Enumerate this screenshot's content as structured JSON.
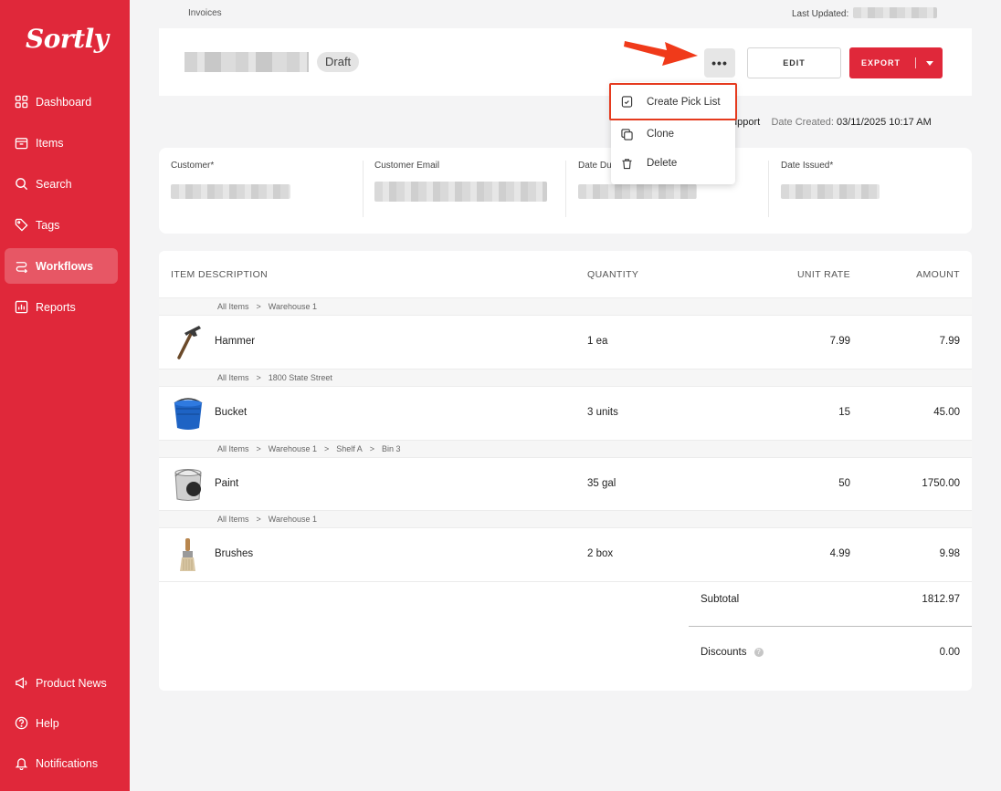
{
  "sidebar": {
    "logo": "Sortly",
    "items": [
      {
        "label": "Dashboard",
        "icon": "dashboard-icon",
        "active": false
      },
      {
        "label": "Items",
        "icon": "items-icon",
        "active": false
      },
      {
        "label": "Search",
        "icon": "search-icon",
        "active": false
      },
      {
        "label": "Tags",
        "icon": "tag-icon",
        "active": false
      },
      {
        "label": "Workflows",
        "icon": "workflows-icon",
        "active": true
      },
      {
        "label": "Reports",
        "icon": "reports-icon",
        "active": false
      }
    ],
    "bottom_items": [
      {
        "label": "Product News",
        "icon": "megaphone-icon"
      },
      {
        "label": "Help",
        "icon": "help-icon"
      },
      {
        "label": "Notifications",
        "icon": "bell-icon"
      }
    ]
  },
  "breadcrumb": "Invoices",
  "last_updated_label": "Last Updated:",
  "header": {
    "status": "Draft",
    "more_label": "•••",
    "edit_label": "EDIT",
    "export_label": "EXPORT"
  },
  "meta": {
    "support_fragment": "upport",
    "date_created_label": "Date Created:",
    "date_created_value": "03/11/2025 10:17 AM"
  },
  "details": {
    "customer_label": "Customer*",
    "email_label": "Customer Email",
    "date_due_label": "Date Du",
    "date_issued_label": "Date Issued*"
  },
  "menu": {
    "items": [
      {
        "label": "Create Pick List",
        "icon": "pick-list-icon"
      },
      {
        "label": "Clone",
        "icon": "clone-icon"
      },
      {
        "label": "Delete",
        "icon": "trash-icon"
      }
    ]
  },
  "table": {
    "headers": {
      "description": "ITEM DESCRIPTION",
      "quantity": "QUANTITY",
      "unit_rate": "UNIT RATE",
      "amount": "AMOUNT"
    },
    "rows": [
      {
        "path": [
          "All Items",
          "Warehouse 1"
        ],
        "name": "Hammer",
        "quantity": "1 ea",
        "unit_rate": "7.99",
        "amount": "7.99",
        "image": "hammer-image"
      },
      {
        "path": [
          "All Items",
          "1800 State Street"
        ],
        "name": "Bucket",
        "quantity": "3 units",
        "unit_rate": "15",
        "amount": "45.00",
        "image": "bucket-image"
      },
      {
        "path": [
          "All Items",
          "Warehouse 1",
          "Shelf A",
          "Bin 3"
        ],
        "name": "Paint",
        "quantity": "35 gal",
        "unit_rate": "50",
        "amount": "1750.00",
        "image": "paint-can-image"
      },
      {
        "path": [
          "All Items",
          "Warehouse 1"
        ],
        "name": "Brushes",
        "quantity": "2 box",
        "unit_rate": "4.99",
        "amount": "9.98",
        "image": "brush-image"
      }
    ],
    "path_separator": ">",
    "subtotal_label": "Subtotal",
    "subtotal_value": "1812.97",
    "discounts_label": "Discounts",
    "discounts_value": "0.00",
    "help_glyph": "?"
  },
  "colors": {
    "brand": "#e0283a",
    "highlight": "#e53a1e"
  }
}
